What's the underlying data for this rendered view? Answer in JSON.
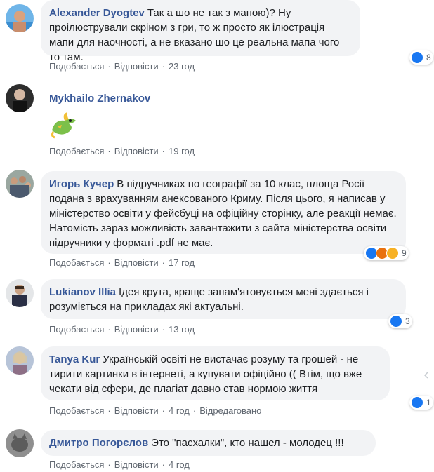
{
  "actions": {
    "like_label": "Подобається",
    "reply_label": "Відповісти",
    "edited_label": "Відредаговано"
  },
  "comments": [
    {
      "author": "Alexander Dyogtev",
      "text": "Так а шо не так з мапою)? Ну проілюстрували скріном з гри, то ж просто як ілюстрація мапи для наочності, а не вказано шо це реальна мапа чого то там.",
      "time": "23 год",
      "reactions": {
        "types": [
          "like"
        ],
        "count": "8"
      }
    },
    {
      "author": "Mykhailo Zhernakov",
      "sticker": "dragon-sticker",
      "time": "19 год"
    },
    {
      "author": "Игорь Кучер",
      "text": "В підручниках по географії за 10 клас, площа Росії подана з врахуванням анексованого Криму. Після цього, я написав у міністерство освіти у фейсбуці на офіційну сторінку, але реакції немає. Натомість зараз можливість завантажити з сайта міністерства освіти підручники у форматі .pdf не має.",
      "time": "17 год",
      "reactions": {
        "types": [
          "like",
          "angry",
          "wow"
        ],
        "count": "9"
      }
    },
    {
      "author": "Lukianov Illia",
      "text": "Ідея крута, краще запам'ятовується мені здається і розуміється на прикладах які актуальні.",
      "time": "13 год",
      "reactions": {
        "types": [
          "like"
        ],
        "count": "3"
      }
    },
    {
      "author": "Tanya Kur",
      "text": "Українській освіті не вистачає розуму та грошей - не тирити картинки в інтернеті, а купувати офіційно (( Втім, що вже чекати від сфери, де плагіат давно став нормою життя",
      "time": "4 год",
      "edited": true,
      "reactions": {
        "types": [
          "like"
        ],
        "count": "1"
      }
    },
    {
      "author": "Дмитро Погорєлов",
      "text": "Это \"пасхалки\", кто нашел - молодец !!!",
      "time": "4 год"
    }
  ],
  "colors": {
    "author": "#385898",
    "bubble": "#f2f3f5",
    "like": "#1877f2",
    "angry": "#e9710f",
    "wow": "#f7b125"
  }
}
